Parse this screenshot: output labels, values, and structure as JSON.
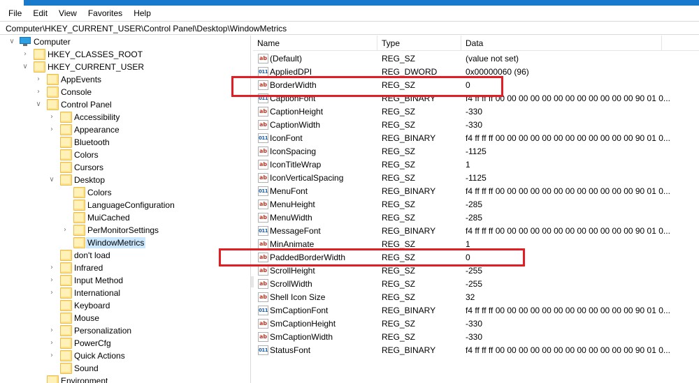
{
  "menu": [
    "File",
    "Edit",
    "View",
    "Favorites",
    "Help"
  ],
  "address": "Computer\\HKEY_CURRENT_USER\\Control Panel\\Desktop\\WindowMetrics",
  "tree": [
    {
      "label": "Computer",
      "level": 0,
      "expander": "expanded",
      "icon": "computer-icon"
    },
    {
      "label": "HKEY_CLASSES_ROOT",
      "level": 1,
      "expander": "collapsed",
      "icon": "folder-icon"
    },
    {
      "label": "HKEY_CURRENT_USER",
      "level": 1,
      "expander": "expanded",
      "icon": "folder-icon"
    },
    {
      "label": "AppEvents",
      "level": 2,
      "expander": "collapsed",
      "icon": "folder-icon"
    },
    {
      "label": "Console",
      "level": 2,
      "expander": "collapsed",
      "icon": "folder-icon"
    },
    {
      "label": "Control Panel",
      "level": 2,
      "expander": "expanded",
      "icon": "folder-icon"
    },
    {
      "label": "Accessibility",
      "level": 3,
      "expander": "collapsed",
      "icon": "folder-icon"
    },
    {
      "label": "Appearance",
      "level": 3,
      "expander": "collapsed",
      "icon": "folder-icon"
    },
    {
      "label": "Bluetooth",
      "level": 3,
      "expander": "none",
      "icon": "folder-icon"
    },
    {
      "label": "Colors",
      "level": 3,
      "expander": "none",
      "icon": "folder-icon"
    },
    {
      "label": "Cursors",
      "level": 3,
      "expander": "none",
      "icon": "folder-icon"
    },
    {
      "label": "Desktop",
      "level": 3,
      "expander": "expanded",
      "icon": "folder-icon"
    },
    {
      "label": "Colors",
      "level": 4,
      "expander": "none",
      "icon": "folder-icon"
    },
    {
      "label": "LanguageConfiguration",
      "level": 4,
      "expander": "none",
      "icon": "folder-icon"
    },
    {
      "label": "MuiCached",
      "level": 4,
      "expander": "none",
      "icon": "folder-icon"
    },
    {
      "label": "PerMonitorSettings",
      "level": 4,
      "expander": "collapsed",
      "icon": "folder-icon"
    },
    {
      "label": "WindowMetrics",
      "level": 4,
      "expander": "none",
      "icon": "folder-icon",
      "selected": true
    },
    {
      "label": "don't load",
      "level": 3,
      "expander": "none",
      "icon": "folder-icon"
    },
    {
      "label": "Infrared",
      "level": 3,
      "expander": "collapsed",
      "icon": "folder-icon"
    },
    {
      "label": "Input Method",
      "level": 3,
      "expander": "collapsed",
      "icon": "folder-icon"
    },
    {
      "label": "International",
      "level": 3,
      "expander": "collapsed",
      "icon": "folder-icon"
    },
    {
      "label": "Keyboard",
      "level": 3,
      "expander": "none",
      "icon": "folder-icon"
    },
    {
      "label": "Mouse",
      "level": 3,
      "expander": "none",
      "icon": "folder-icon"
    },
    {
      "label": "Personalization",
      "level": 3,
      "expander": "collapsed",
      "icon": "folder-icon"
    },
    {
      "label": "PowerCfg",
      "level": 3,
      "expander": "collapsed",
      "icon": "folder-icon"
    },
    {
      "label": "Quick Actions",
      "level": 3,
      "expander": "collapsed",
      "icon": "folder-icon"
    },
    {
      "label": "Sound",
      "level": 3,
      "expander": "none",
      "icon": "folder-icon"
    },
    {
      "label": "Environment",
      "level": 2,
      "expander": "none",
      "icon": "folder-icon"
    }
  ],
  "columns": {
    "name": "Name",
    "type": "Type",
    "data": "Data"
  },
  "values": [
    {
      "name": "(Default)",
      "type": "REG_SZ",
      "data": "(value not set)",
      "icon": "string-value-icon"
    },
    {
      "name": "AppliedDPI",
      "type": "REG_DWORD",
      "data": "0x00000060 (96)",
      "icon": "binary-value-icon"
    },
    {
      "name": "BorderWidth",
      "type": "REG_SZ",
      "data": "0",
      "icon": "string-value-icon",
      "highlighted": true
    },
    {
      "name": "CaptionFont",
      "type": "REG_BINARY",
      "data": "f4 ff ff ff 00 00 00 00 00 00 00 00 00 00 00 00 90 01 0...",
      "icon": "binary-value-icon"
    },
    {
      "name": "CaptionHeight",
      "type": "REG_SZ",
      "data": "-330",
      "icon": "string-value-icon"
    },
    {
      "name": "CaptionWidth",
      "type": "REG_SZ",
      "data": "-330",
      "icon": "string-value-icon"
    },
    {
      "name": "IconFont",
      "type": "REG_BINARY",
      "data": "f4 ff ff ff 00 00 00 00 00 00 00 00 00 00 00 00 90 01 0...",
      "icon": "binary-value-icon"
    },
    {
      "name": "IconSpacing",
      "type": "REG_SZ",
      "data": "-1125",
      "icon": "string-value-icon"
    },
    {
      "name": "IconTitleWrap",
      "type": "REG_SZ",
      "data": "1",
      "icon": "string-value-icon"
    },
    {
      "name": "IconVerticalSpacing",
      "type": "REG_SZ",
      "data": "-1125",
      "icon": "string-value-icon"
    },
    {
      "name": "MenuFont",
      "type": "REG_BINARY",
      "data": "f4 ff ff ff 00 00 00 00 00 00 00 00 00 00 00 00 90 01 0...",
      "icon": "binary-value-icon"
    },
    {
      "name": "MenuHeight",
      "type": "REG_SZ",
      "data": "-285",
      "icon": "string-value-icon"
    },
    {
      "name": "MenuWidth",
      "type": "REG_SZ",
      "data": "-285",
      "icon": "string-value-icon"
    },
    {
      "name": "MessageFont",
      "type": "REG_BINARY",
      "data": "f4 ff ff ff 00 00 00 00 00 00 00 00 00 00 00 00 90 01 0...",
      "icon": "binary-value-icon"
    },
    {
      "name": "MinAnimate",
      "type": "REG_SZ",
      "data": "1",
      "icon": "string-value-icon"
    },
    {
      "name": "PaddedBorderWidth",
      "type": "REG_SZ",
      "data": "0",
      "icon": "string-value-icon",
      "highlighted": true
    },
    {
      "name": "ScrollHeight",
      "type": "REG_SZ",
      "data": "-255",
      "icon": "string-value-icon"
    },
    {
      "name": "ScrollWidth",
      "type": "REG_SZ",
      "data": "-255",
      "icon": "string-value-icon"
    },
    {
      "name": "Shell Icon Size",
      "type": "REG_SZ",
      "data": "32",
      "icon": "string-value-icon"
    },
    {
      "name": "SmCaptionFont",
      "type": "REG_BINARY",
      "data": "f4 ff ff ff 00 00 00 00 00 00 00 00 00 00 00 00 90 01 0...",
      "icon": "binary-value-icon"
    },
    {
      "name": "SmCaptionHeight",
      "type": "REG_SZ",
      "data": "-330",
      "icon": "string-value-icon"
    },
    {
      "name": "SmCaptionWidth",
      "type": "REG_SZ",
      "data": "-330",
      "icon": "string-value-icon"
    },
    {
      "name": "StatusFont",
      "type": "REG_BINARY",
      "data": "f4 ff ff ff 00 00 00 00 00 00 00 00 00 00 00 00 90 01 0...",
      "icon": "binary-value-icon"
    }
  ],
  "colors": {
    "highlight_box": "#e21d23",
    "selection": "#cce8ff",
    "title_band": "#1979ca"
  }
}
